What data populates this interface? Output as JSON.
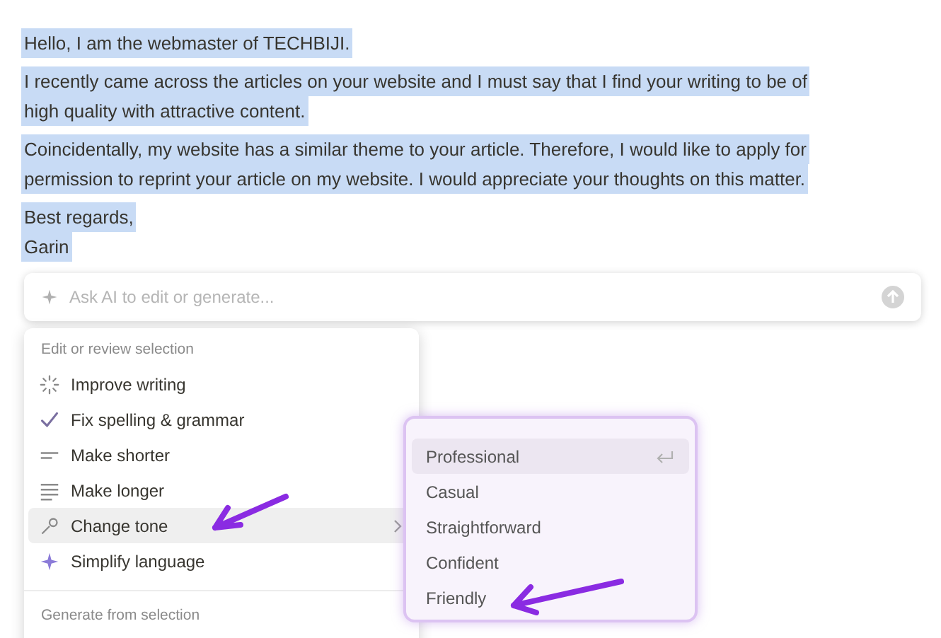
{
  "document": {
    "paragraphs": [
      {
        "lines": [
          "Hello, I am the webmaster of TECHBIJI."
        ]
      },
      {
        "lines": [
          "I recently came across the articles on your website and I must say that I find your writing to be of",
          "high quality with attractive content."
        ]
      },
      {
        "lines": [
          "Coincidentally, my website has a similar theme to your article. Therefore, I would like to apply for",
          "permission to reprint your article on my website. I would appreciate your thoughts on this matter."
        ]
      },
      {
        "lines": [
          "Best regards,",
          "Garin"
        ]
      }
    ]
  },
  "ai_prompt": {
    "placeholder": "Ask AI to edit or generate..."
  },
  "menu": {
    "section_title": "Edit or review selection",
    "items": [
      {
        "label": "Improve writing",
        "selected": false,
        "has_submenu": false
      },
      {
        "label": "Fix spelling & grammar",
        "selected": false,
        "has_submenu": false
      },
      {
        "label": "Make shorter",
        "selected": false,
        "has_submenu": false
      },
      {
        "label": "Make longer",
        "selected": false,
        "has_submenu": false
      },
      {
        "label": "Change tone",
        "selected": true,
        "has_submenu": true
      },
      {
        "label": "Simplify language",
        "selected": false,
        "has_submenu": false
      }
    ],
    "section_title_2": "Generate from selection"
  },
  "submenu": {
    "items": [
      {
        "label": "Professional",
        "selected": true
      },
      {
        "label": "Casual",
        "selected": false
      },
      {
        "label": "Straightforward",
        "selected": false
      },
      {
        "label": "Confident",
        "selected": false
      },
      {
        "label": "Friendly",
        "selected": false
      }
    ]
  }
}
